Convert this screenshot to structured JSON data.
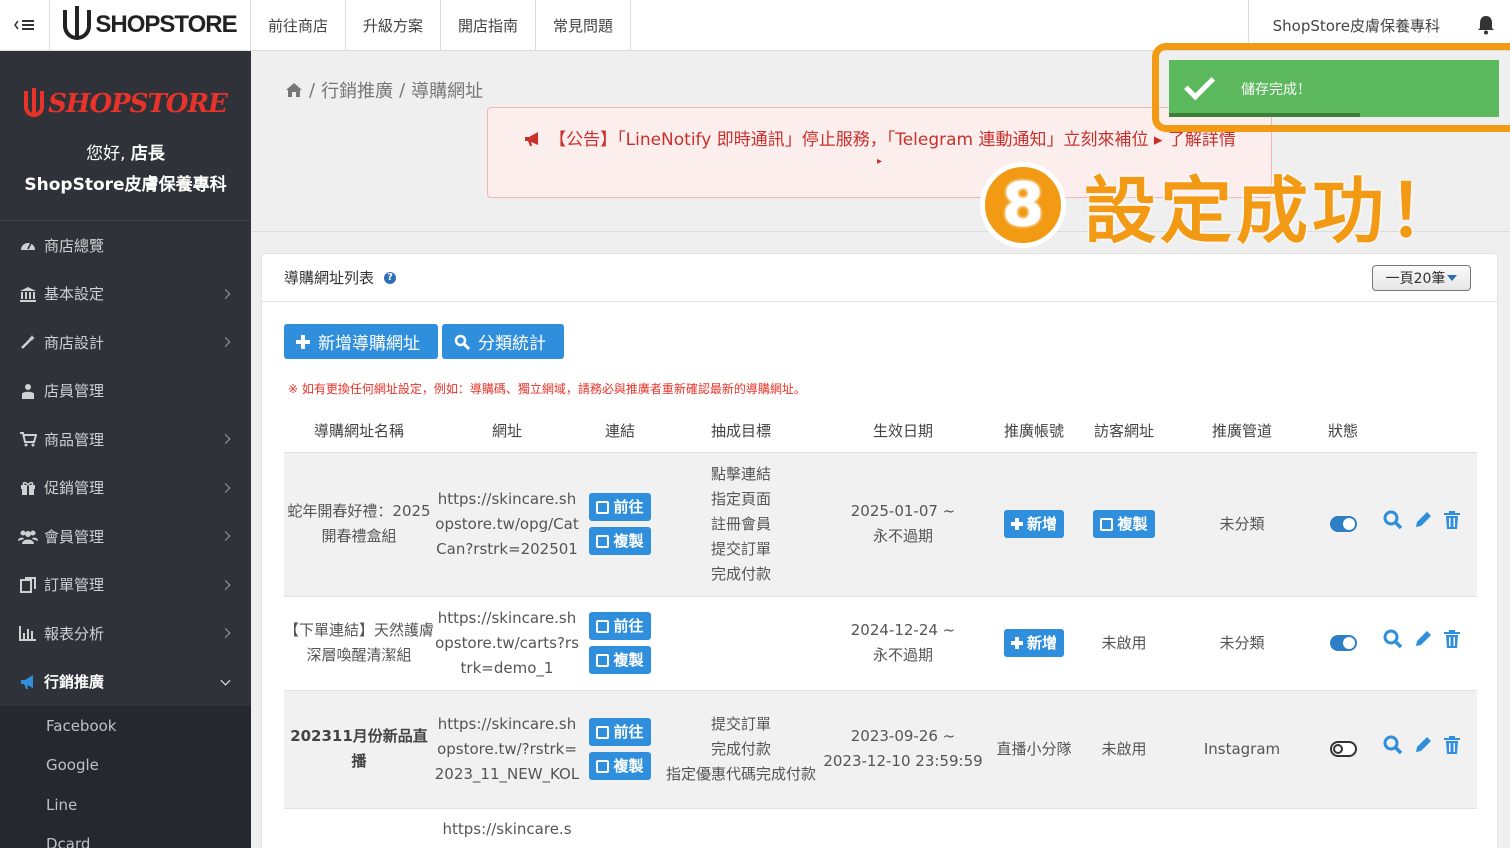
{
  "topbar": {
    "logo": "SHOPSTORE",
    "nav": [
      "前往商店",
      "升級方案",
      "開店指南",
      "常見問題"
    ],
    "store_name": "ShopStore皮膚保養專科"
  },
  "sidebar": {
    "brand": "SHOPSTORE",
    "greeting": "您好,",
    "role": "店長",
    "store": "ShopStore皮膚保養專科",
    "menu": [
      {
        "label": "商店總覽",
        "icon": "dashboard-icon"
      },
      {
        "label": "基本設定",
        "icon": "bank-icon"
      },
      {
        "label": "商店設計",
        "icon": "magic-wand-icon"
      },
      {
        "label": "店員管理",
        "icon": "staff-icon"
      },
      {
        "label": "商品管理",
        "icon": "cart-icon"
      },
      {
        "label": "促銷管理",
        "icon": "gift-icon"
      },
      {
        "label": "會員管理",
        "icon": "users-icon"
      },
      {
        "label": "訂單管理",
        "icon": "order-icon"
      },
      {
        "label": "報表分析",
        "icon": "bar-chart-icon"
      },
      {
        "label": "行銷推廣",
        "icon": "megaphone-icon"
      }
    ],
    "submenu": [
      "Facebook",
      "Google",
      "Line",
      "Dcard"
    ]
  },
  "breadcrumb": {
    "sep": "/",
    "level1": "行銷推廣",
    "level2": "導購網址"
  },
  "announcement": {
    "line1": "【公告】「LineNotify 即時通訊」停止服務，「Telegram 連動通知」立刻來補位 ▸ 了解詳情",
    "line2": "▸"
  },
  "panel": {
    "title": "導購網址列表",
    "per_page": "一頁20筆",
    "add_button": "新增導購網址",
    "stats_button": "分類統計",
    "warning": "※ 如有更換任何網址設定，例如：導購碼、獨立網域，請務必與推廣者重新確認最新的導購網址。"
  },
  "table": {
    "headers": [
      "導購網址名稱",
      "網址",
      "連結",
      "抽成目標",
      "生效日期",
      "推廣帳號",
      "訪客網址",
      "推廣管道",
      "狀態"
    ],
    "btn_go": "前往",
    "btn_copy": "複製",
    "btn_add": "新增",
    "rows": [
      {
        "name": "蛇年開春好禮：2025 開春禮盒組",
        "url": "https://skincare.shopstore.tw/opg/CatCan?rstrk=202501",
        "targets": [
          "點擊連結",
          "指定頁面",
          "註冊會員",
          "提交訂單",
          "完成付款"
        ],
        "date_from": "2025-01-07 ~",
        "date_to": "永不過期",
        "account": "",
        "visitor": "",
        "channel": "未分類",
        "status": "on"
      },
      {
        "name": "【下單連結】天然護膚深層喚醒清潔組",
        "url": "https://skincare.shopstore.tw/carts?rstrk=demo_1",
        "targets": [],
        "date_from": "2024-12-24 ~",
        "date_to": "永不過期",
        "account": "",
        "visitor": "未啟用",
        "channel": "未分類",
        "status": "on"
      },
      {
        "name": "202311月份新品直播",
        "url": "https://skincare.shopstore.tw/?rstrk=2023_11_NEW_KOL",
        "targets": [
          "提交訂單",
          "完成付款",
          "指定優惠代碼完成付款"
        ],
        "date_from": "2023-09-26 ~",
        "date_to": "2023-12-10 23:59:59",
        "account": "直播小分隊",
        "visitor": "未啟用",
        "channel": "Instagram",
        "status": "off"
      },
      {
        "name": "",
        "url": "https://skincare.s",
        "targets": [],
        "date_from": "",
        "date_to": "",
        "account": "",
        "visitor": "",
        "channel": "",
        "status": ""
      }
    ]
  },
  "toast": {
    "message": "儲存完成！"
  },
  "annotation": {
    "number": "8",
    "text": "設定成功！"
  },
  "colors": {
    "accent": "#2f8fdc",
    "success": "#5cb85c",
    "annotation": "#f39a14",
    "danger": "#e8332a",
    "sidebar": "#2f3238"
  }
}
